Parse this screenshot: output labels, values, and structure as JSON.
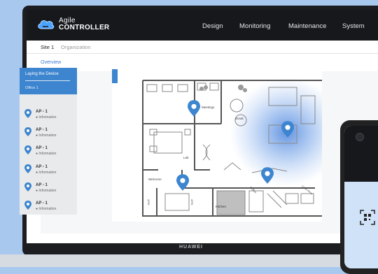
{
  "app": {
    "logo_line1": "Agile",
    "logo_line2": "CONTROLLER"
  },
  "nav": {
    "items": [
      {
        "label": "Design"
      },
      {
        "label": "Monitoring"
      },
      {
        "label": "Maintenance"
      },
      {
        "label": "System"
      }
    ]
  },
  "breadcrumb": {
    "site": "Site 1",
    "org": "Organization"
  },
  "overview_link": "Overview",
  "sidebar": {
    "title": "Laying the Device",
    "subtitle": "Office 1",
    "items": [
      {
        "name": "AP - 1",
        "info": "Information"
      },
      {
        "name": "AP - 1",
        "info": "Information"
      },
      {
        "name": "AP - 1",
        "info": "Information"
      },
      {
        "name": "AP - 1",
        "info": "Information"
      },
      {
        "name": "AP - 1",
        "info": "Information"
      },
      {
        "name": "AP - 1",
        "info": "Information"
      }
    ]
  },
  "floor_labels": {
    "meetings": "Meetings",
    "break": "Break",
    "lab": "Lab",
    "welcome": "Welcome",
    "kitchen": "Kitchen",
    "stuff1": "Stuff",
    "stuff2": "Stuff",
    "coffee": "Coffee",
    "lean_area": "Lean Area"
  },
  "device_brand": "HUAWEI",
  "colors": {
    "accent": "#3d85cf",
    "topbar": "#16181c",
    "background": "#a9c8ee"
  }
}
